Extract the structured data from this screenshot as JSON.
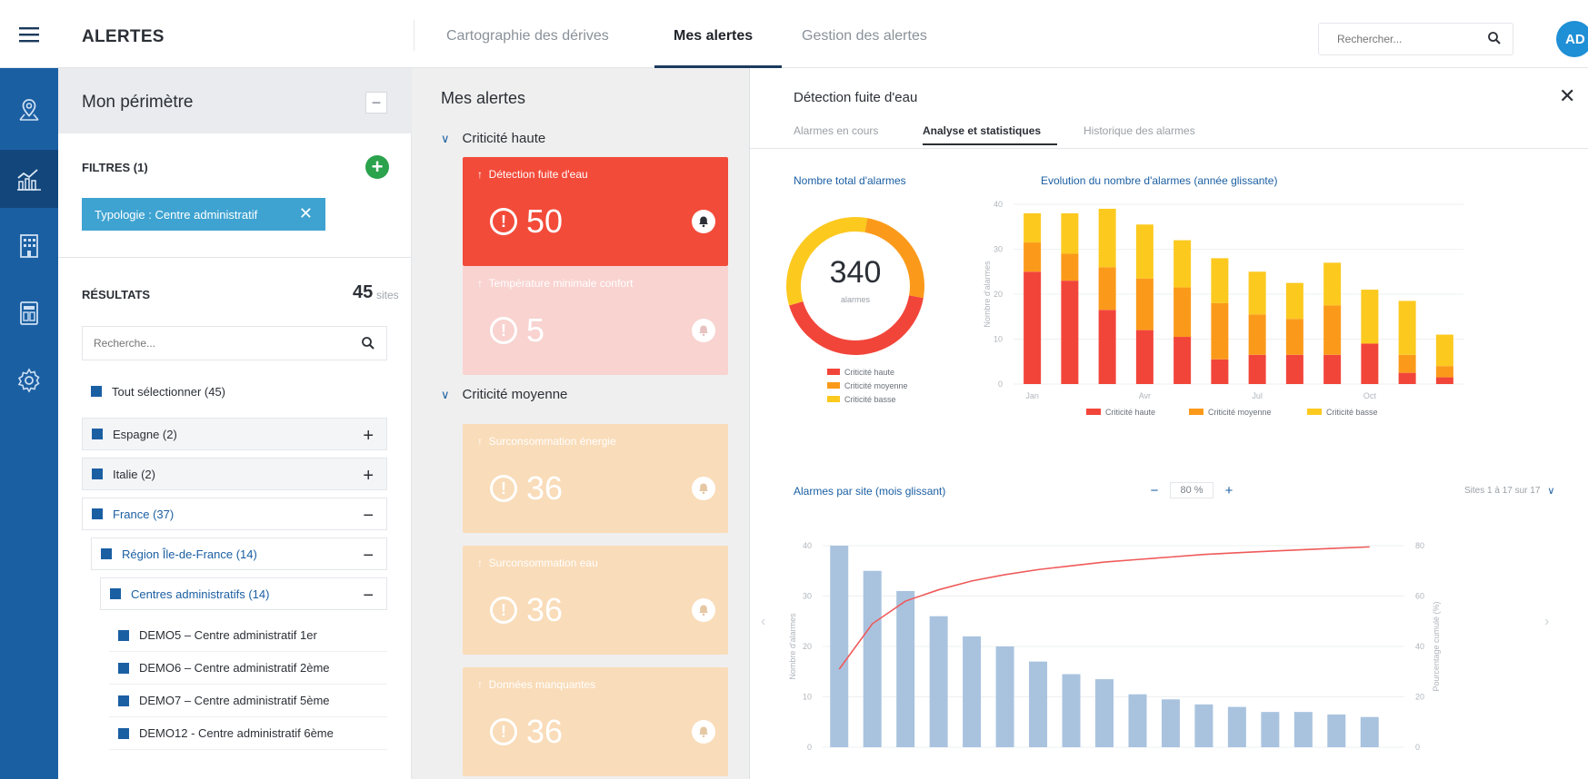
{
  "header": {
    "app_title": "ALERTES",
    "tabs": [
      {
        "label": "Cartographie des dérives",
        "active": false
      },
      {
        "label": "Mes alertes",
        "active": true
      },
      {
        "label": "Gestion des alertes",
        "active": false
      }
    ],
    "search_placeholder": "Rechercher...",
    "avatar_initials": "AD"
  },
  "sidebar": {
    "items": [
      {
        "icon": "map-pin-icon",
        "active": false
      },
      {
        "icon": "chart-icon",
        "active": true
      },
      {
        "icon": "building-icon",
        "active": false
      },
      {
        "icon": "dashboard-icon",
        "active": false
      },
      {
        "icon": "gear-icon",
        "active": false
      }
    ]
  },
  "perimeter": {
    "title": "Mon périmètre",
    "collapse_label": "−",
    "filters_label": "FILTRES (1)",
    "add_filter_label": "+",
    "chip_label": "Typologie : Centre administratif",
    "results_label": "RÉSULTATS",
    "results_count": "45",
    "results_unit": "sites",
    "search_placeholder": "Recherche...",
    "tree": [
      {
        "label": "Tout sélectionner (45)",
        "toggle": ""
      },
      {
        "label": "Espagne (2)",
        "toggle": "+"
      },
      {
        "label": "Italie (2)",
        "toggle": "+"
      },
      {
        "label": "France (37)",
        "toggle": "−"
      },
      {
        "label": "Région Île-de-France (14)",
        "toggle": "−"
      },
      {
        "label": "Centres administratifs (14)",
        "toggle": "−"
      },
      {
        "label": "DEMO5 – Centre administratif 1er",
        "toggle": ""
      },
      {
        "label": "DEMO6 – Centre administratif 2ème",
        "toggle": ""
      },
      {
        "label": "DEMO7 – Centre administratif 5ème",
        "toggle": ""
      },
      {
        "label": "DEMO12 - Centre administratif 6ème",
        "toggle": ""
      }
    ]
  },
  "alerts": {
    "title": "Mes alertes",
    "groups": [
      {
        "label": "Criticité haute"
      },
      {
        "label": "Criticité moyenne"
      }
    ],
    "cards": [
      {
        "name": "Détection fuite d'eau",
        "count": "50",
        "style": "active"
      },
      {
        "name": "Température minimale confort",
        "count": "5",
        "style": "faded-red"
      },
      {
        "name": "Surconsommation énergie",
        "count": "36",
        "style": "faded-orange"
      },
      {
        "name": "Surconsommation eau",
        "count": "36",
        "style": "faded-orange"
      },
      {
        "name": "Données manquantes",
        "count": "36",
        "style": "faded-orange"
      }
    ]
  },
  "detail": {
    "title": "Détection fuite d'eau",
    "tabs": [
      {
        "label": "Alarmes en cours",
        "active": false
      },
      {
        "label": "Analyse et statistiques",
        "active": true
      },
      {
        "label": "Historique des alarmes",
        "active": false
      }
    ],
    "donut_title": "Nombre total d'alarmes",
    "evolution_title": "Evolution du nombre d'alarmes (année glissante)",
    "pareto_title": "Alarmes par site (mois glissant)",
    "zoom_label": "80 %",
    "site_range": "Sites 1 à 17 sur 17"
  },
  "colors": {
    "haute": "#f2453a",
    "moyenne": "#fb9a1a",
    "basse": "#fcc91f",
    "site_bar": "#a9c3df",
    "cumul_line": "#ef5a5a"
  },
  "chart_data": [
    {
      "type": "pie",
      "title": "Nombre total d'alarmes",
      "total": "340",
      "total_unit": "alarmes",
      "labels": [
        "Criticité haute",
        "Criticité moyenne",
        "Criticité basse"
      ],
      "values": [
        145,
        85,
        110
      ]
    },
    {
      "type": "bar",
      "stacked": true,
      "title": "Evolution du nombre d'alarmes (année glissante)",
      "ylabel": "Nombre d'alarmes",
      "ylim": [
        0,
        40
      ],
      "yticks": [
        0,
        10,
        20,
        30,
        40
      ],
      "xtick_labels": [
        "Jan",
        "Avr",
        "Jul",
        "Oct"
      ],
      "categories": [
        "1",
        "2",
        "3",
        "4",
        "5",
        "6",
        "7",
        "8",
        "9",
        "10",
        "11",
        "12"
      ],
      "series": [
        {
          "name": "Criticité haute",
          "values": [
            25,
            23,
            16.5,
            12,
            10.5,
            5.5,
            6.5,
            6.5,
            6.5,
            9,
            2.5,
            1.5
          ]
        },
        {
          "name": "Criticité moyenne",
          "values": [
            6.5,
            6,
            9.5,
            11.5,
            11,
            12.5,
            9,
            8,
            11,
            0,
            4,
            2.5
          ]
        },
        {
          "name": "Criticité basse",
          "values": [
            6.5,
            9,
            13,
            12,
            10.5,
            10,
            9.5,
            8,
            9.5,
            12,
            12,
            7
          ]
        }
      ]
    },
    {
      "type": "bar",
      "title": "Alarmes par site (mois glissant)",
      "ylabel": "Nombre d'alarmes",
      "y2label": "Pourcentage cumulé (%)",
      "ylim": [
        0,
        40
      ],
      "yticks": [
        0,
        10,
        20,
        30,
        40
      ],
      "y2lim": [
        0,
        80
      ],
      "y2ticks": [
        0,
        20,
        40,
        60,
        80
      ],
      "categories": [
        "1",
        "2",
        "3",
        "4",
        "5",
        "6",
        "7",
        "8",
        "9",
        "10",
        "11",
        "12",
        "13",
        "14",
        "15",
        "16",
        "17"
      ],
      "values": [
        40,
        35,
        31,
        26,
        22,
        20,
        17,
        14.5,
        13.5,
        10.5,
        9.5,
        8.5,
        8,
        7,
        7,
        6.5,
        6
      ],
      "cumulative_line": [
        31,
        49,
        58,
        62.5,
        66,
        68.5,
        70.5,
        72,
        73.5,
        74.5,
        75.5,
        76.5,
        77.2,
        77.8,
        78.4,
        79,
        79.5
      ]
    }
  ]
}
